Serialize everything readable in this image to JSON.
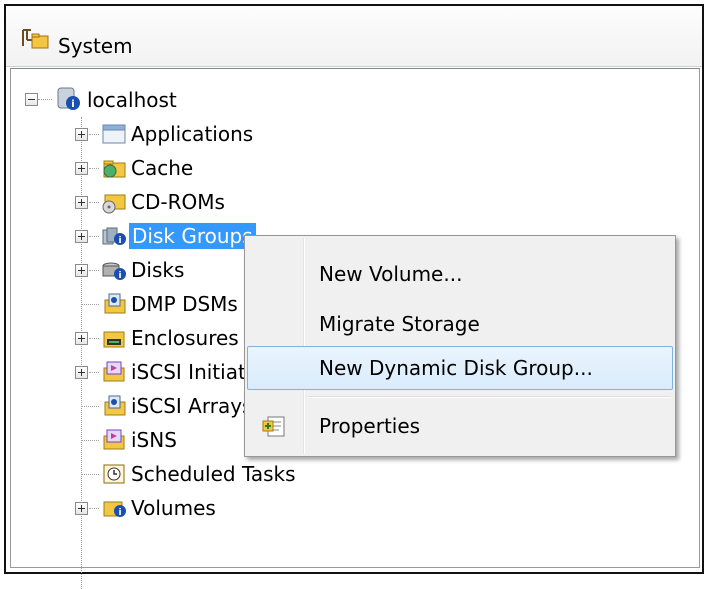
{
  "window": {
    "title": "System"
  },
  "tree": {
    "root": {
      "label": "localhost"
    },
    "items": [
      {
        "label": "Applications"
      },
      {
        "label": "Cache"
      },
      {
        "label": "CD-ROMs"
      },
      {
        "label": "Disk Groups"
      },
      {
        "label": "Disks"
      },
      {
        "label": "DMP DSMs"
      },
      {
        "label": "Enclosures"
      },
      {
        "label": "iSCSI Initiators"
      },
      {
        "label": "iSCSI Arrays"
      },
      {
        "label": "iSNS"
      },
      {
        "label": "Scheduled Tasks"
      },
      {
        "label": "Volumes"
      }
    ]
  },
  "context_menu": {
    "items": [
      {
        "label": "New Volume..."
      },
      {
        "label": "Migrate Storage"
      },
      {
        "label": "New Dynamic Disk Group..."
      },
      {
        "label": "Properties"
      }
    ]
  },
  "colors": {
    "selection": "#3399ff",
    "menu_hover_border": "#7fb2e0"
  }
}
